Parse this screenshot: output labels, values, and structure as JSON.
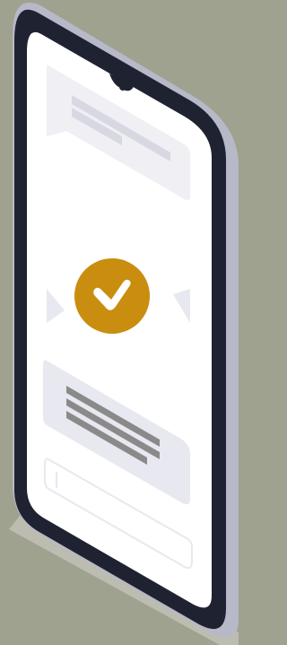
{
  "scene": {
    "type": "isometric-phone-illustration",
    "colors": {
      "background": "#a0a290",
      "shadow": "#bcbdb0",
      "phone_side": "#b7b9c9",
      "phone_bezel": "#1f2230",
      "screen": "#ffffff",
      "bubble": "#e8e8f0",
      "bubble_light": "#efeff4",
      "accent": "#c98e0f",
      "check": "#ffffff",
      "text_line_dark": "#8a8a8a",
      "text_line_light": "#d8d8e2"
    }
  },
  "icons": {
    "status": "check-circle-icon",
    "notch": "camera-notch-icon",
    "prev": "triangle-left-icon",
    "next": "triangle-right-icon"
  }
}
